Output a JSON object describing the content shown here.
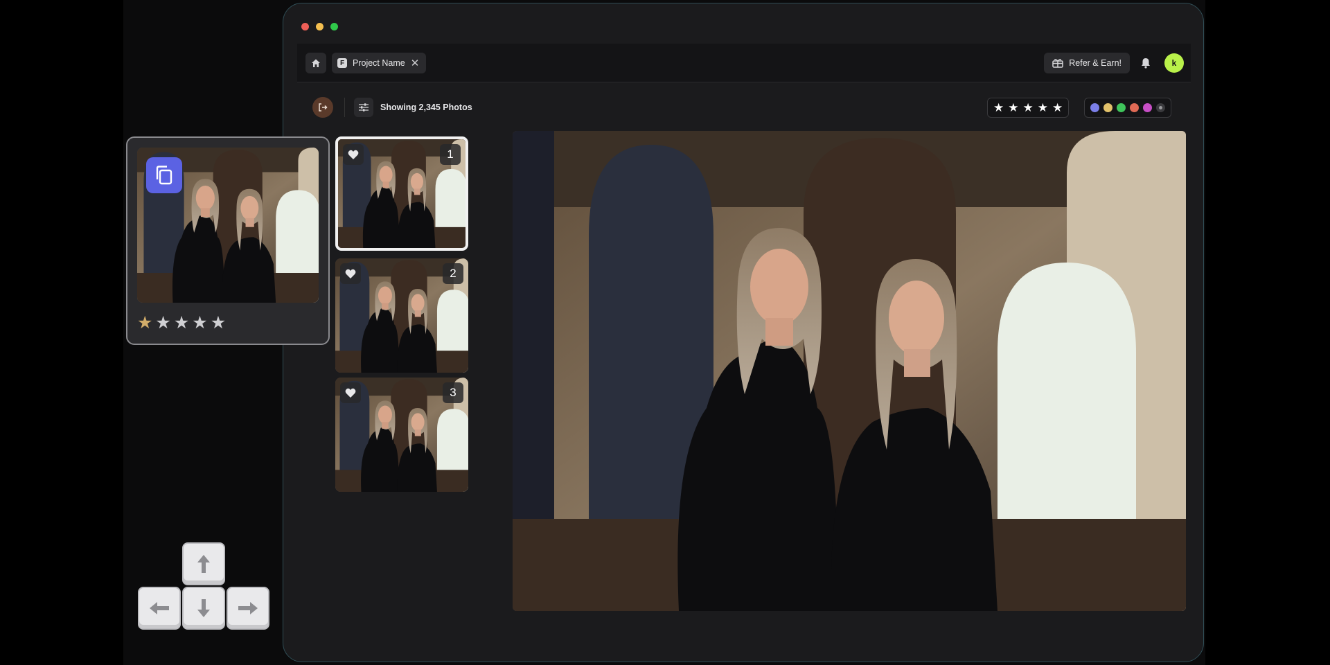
{
  "window": {
    "traffic_colors": [
      "#ee5f57",
      "#f4bf4f",
      "#30c84a"
    ]
  },
  "topbar": {
    "home_icon": "home-icon",
    "project_tab": {
      "label": "Project Name",
      "close_icon": "close-icon"
    },
    "refer_button": {
      "label": "Refer & Earn!",
      "icon": "gift-icon"
    },
    "notifications_icon": "bell-icon",
    "avatar": {
      "initial": "k",
      "color": "#b9f14a"
    }
  },
  "toolbar": {
    "exit_icon": "exit-icon",
    "filter_icon": "sliders-icon",
    "showing_label": "Showing 2,345 Photos",
    "rating_filter": {
      "stars": [
        "★",
        "★",
        "★",
        "★",
        "★"
      ]
    },
    "color_filter": {
      "colors": [
        "#7b7fe8",
        "#e2c16a",
        "#3fc45b",
        "#e06a55",
        "#c84fc6"
      ],
      "none_label": "no-color"
    }
  },
  "filmstrip": {
    "items": [
      {
        "number": "1",
        "favorite_icon": "heart-icon",
        "selected": true
      },
      {
        "number": "2",
        "favorite_icon": "heart-icon",
        "selected": false
      },
      {
        "number": "3",
        "favorite_icon": "heart-icon",
        "selected": false
      }
    ]
  },
  "floating_card": {
    "copy_icon": "copy-icon",
    "stars": [
      "★",
      "★",
      "★",
      "★",
      "★"
    ],
    "rating": 1,
    "rating_max": 5,
    "star_color_active": "#d2ad6a",
    "star_color_inactive": "#cfcfd2"
  },
  "arrow_keys": [
    "arrow-up-icon",
    "arrow-left-icon",
    "arrow-down-icon",
    "arrow-right-icon"
  ],
  "colors": {
    "window_bg": "#1b1b1d",
    "accent_avatar": "#b9f14a",
    "copy_button": "#5b62e3"
  }
}
